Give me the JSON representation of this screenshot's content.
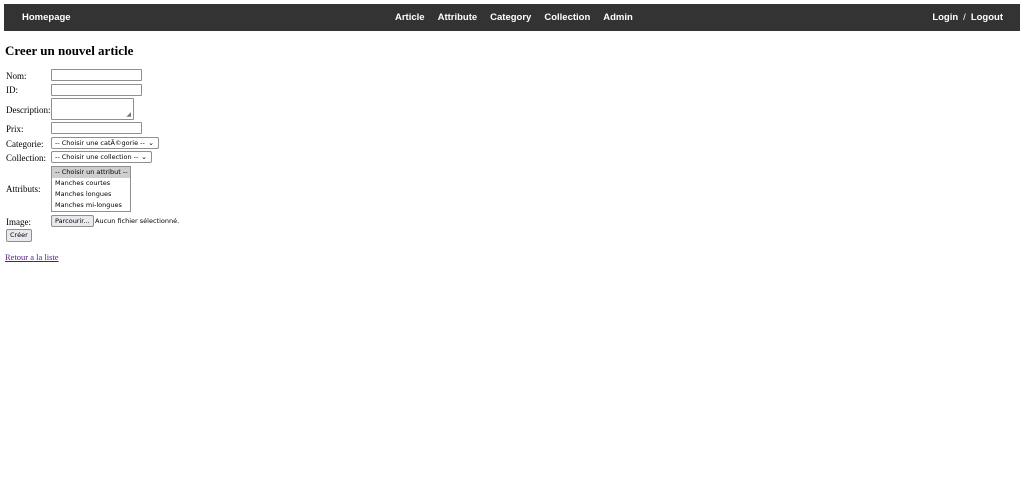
{
  "navbar": {
    "home": "Homepage",
    "links": [
      "Article",
      "Attribute",
      "Category",
      "Collection",
      "Admin"
    ],
    "login": "Login",
    "separator": "/",
    "logout": "Logout"
  },
  "form": {
    "title": "Creer un nouvel article",
    "labels": {
      "nom": "Nom:",
      "id": "ID:",
      "description": "Description:",
      "prix": "Prix:",
      "categorie": "Categorie:",
      "collection": "Collection:",
      "attributs": "Attributs:",
      "image": "Image:"
    },
    "values": {
      "nom": "",
      "id": "",
      "description": "",
      "prix": ""
    },
    "categorie_selected": "-- Choisir une catÃ©gorie --",
    "collection_selected": "-- Choisir une collection --",
    "attributs_options": [
      "-- Choisir un attribut --",
      "Manches courtes",
      "Manches longues",
      "Manches mi-longues"
    ],
    "file_button": "Parcourir...",
    "file_status": "Aucun fichier sélectionné.",
    "submit": "Créer"
  },
  "back_link": "Retour a la liste"
}
